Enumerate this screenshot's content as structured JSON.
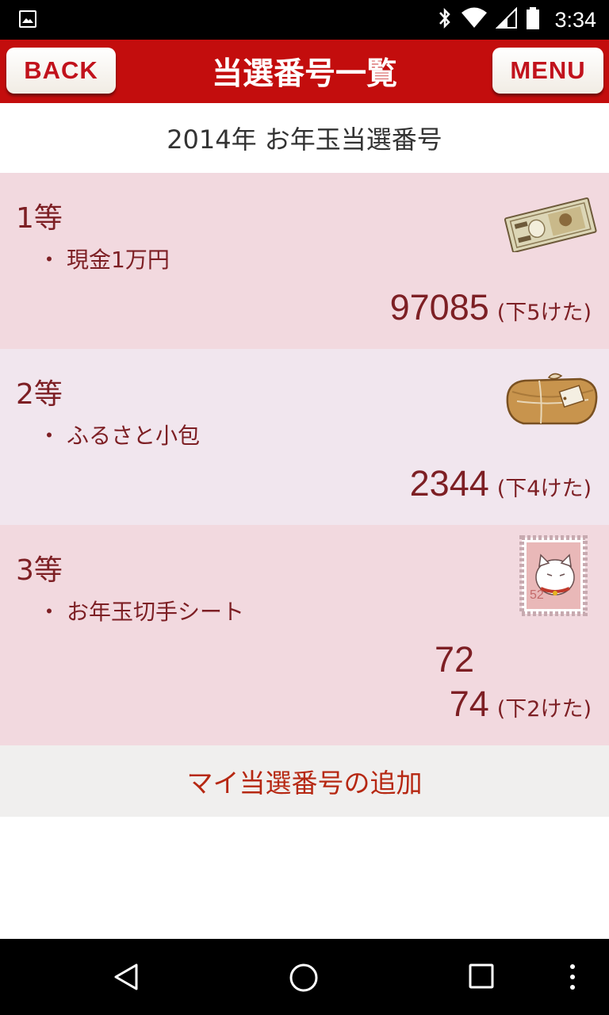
{
  "status_bar": {
    "time": "3:34"
  },
  "header": {
    "back_label": "BACK",
    "title": "当選番号一覧",
    "menu_label": "MENU"
  },
  "subtitle": "2014年 お年玉当選番号",
  "prizes": [
    {
      "rank": "1等",
      "item": "現金1万円",
      "icon": "banknote-icon",
      "numbers": [
        "97085"
      ],
      "note": "(下5けた)"
    },
    {
      "rank": "2等",
      "item": "ふるさと小包",
      "icon": "parcel-icon",
      "numbers": [
        "2344"
      ],
      "note": "(下4けた)"
    },
    {
      "rank": "3等",
      "item": "お年玉切手シート",
      "icon": "stamp-icon",
      "numbers": [
        "72",
        "74"
      ],
      "note": "(下2けた)",
      "stamp_value": "52"
    }
  ],
  "bullet": "・",
  "add_button_label": "マイ当選番号の追加",
  "colors": {
    "header_red": "#c30d0d",
    "text_maroon": "#7d1f24",
    "add_text": "#b62812",
    "row_pink": "#f2d9df",
    "row_lavender": "#f1e6ee"
  }
}
